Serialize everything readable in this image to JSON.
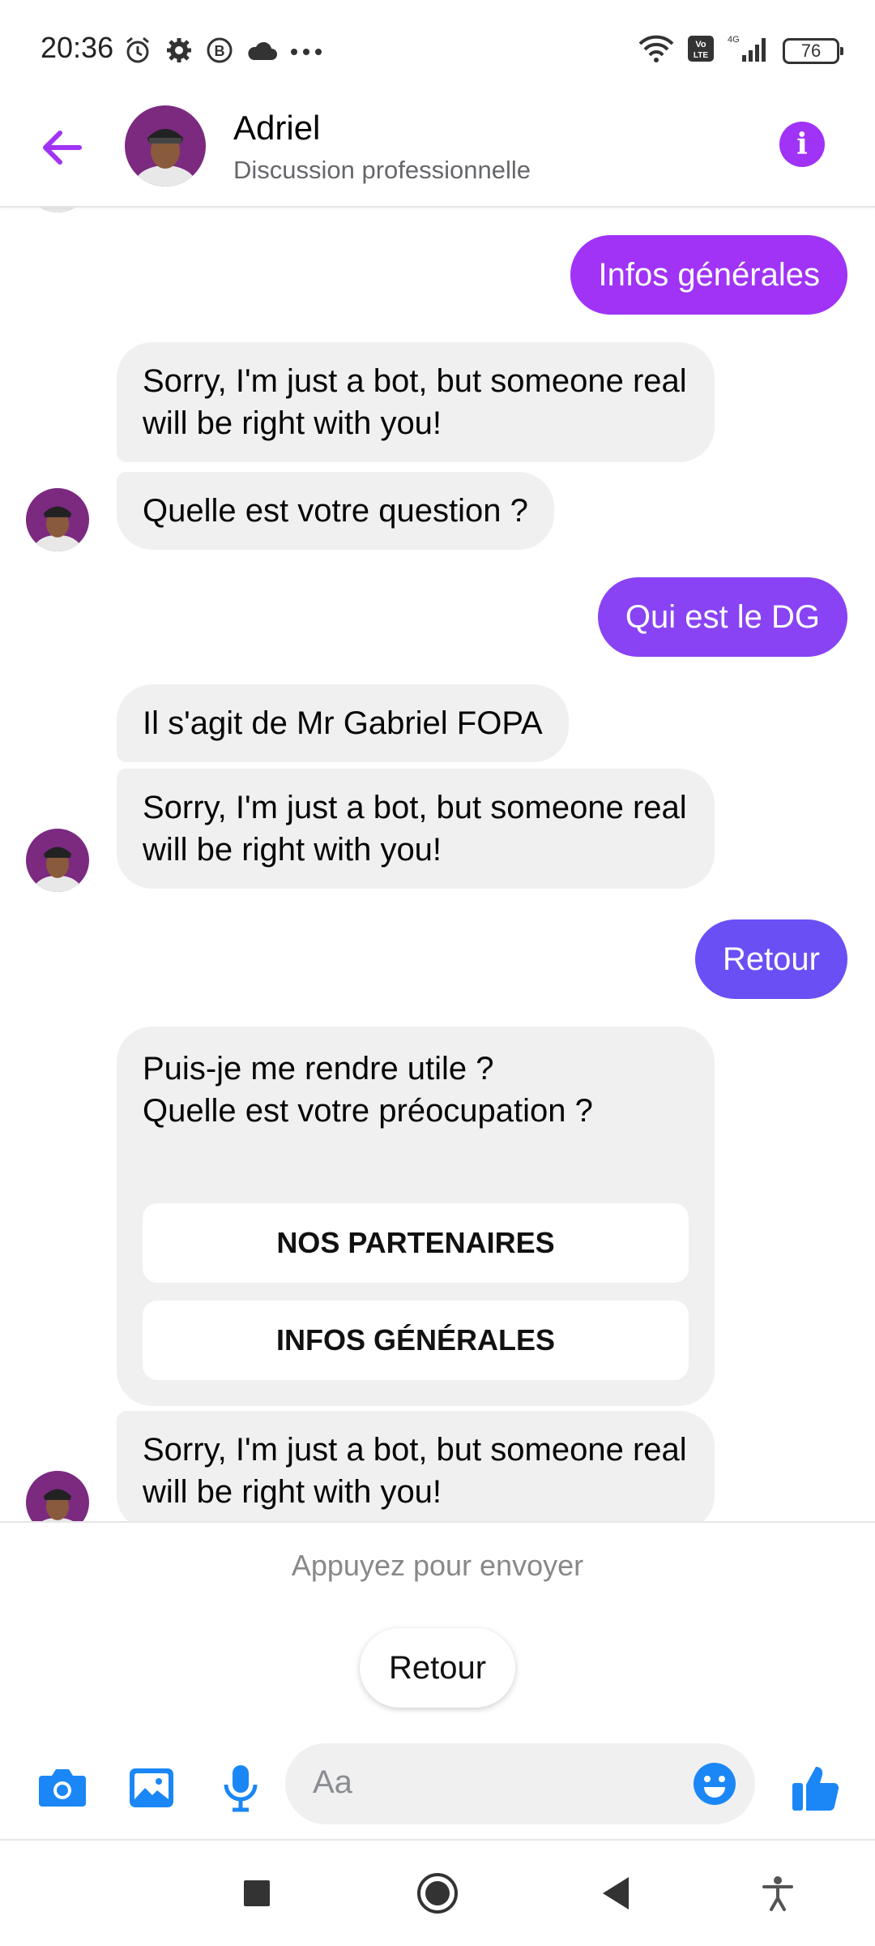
{
  "status_bar": {
    "time": "20:36",
    "battery": "76",
    "network": "4G",
    "icons_left": [
      "alarm-icon",
      "settings-icon",
      "b-circle-icon",
      "cloud-icon",
      "more-dots-icon"
    ],
    "icons_right": [
      "wifi-icon",
      "volte-icon",
      "signal-icon",
      "battery-icon"
    ]
  },
  "header": {
    "name": "Adriel",
    "subtitle": "Discussion professionnelle",
    "accent_color": "#a033f6"
  },
  "messages": {
    "m1": "Infos générales",
    "m2": "Sorry, I'm just a bot, but someone real will be right with you!",
    "m3": "Quelle est votre question ?",
    "m4": "Qui est le DG",
    "m5": "Il s'agit de Mr Gabriel FOPA",
    "m6": "Sorry, I'm just a bot, but someone real will be right with you!",
    "m7": "Retour",
    "m8_text": "Puis-je me rendre utile ?\nQuelle est votre préocupation ?",
    "m8_buttons": [
      "NOS PARTENAIRES",
      "INFOS GÉNÉRALES"
    ],
    "m9": "Sorry, I'm just a bot, but someone real will be right with you!"
  },
  "quick_replies": {
    "hint": "Appuyez pour envoyer",
    "chips": [
      "Retour"
    ]
  },
  "composer": {
    "placeholder": "Aa",
    "icons": [
      "camera-icon",
      "image-icon",
      "microphone-icon",
      "emoji-icon",
      "thumbs-up-icon"
    ]
  },
  "colors": {
    "bubble_out_1": "#a033f6",
    "bubble_out_2": "#8943f4",
    "bubble_out_3": "#6a4ff5",
    "bubble_in": "#f0f0f0",
    "icon_blue": "#1b87f6"
  }
}
